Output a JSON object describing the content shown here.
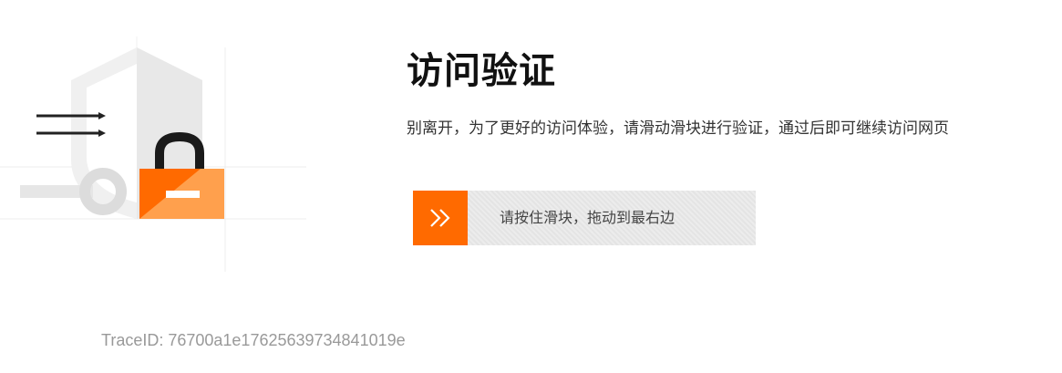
{
  "verification": {
    "title": "访问验证",
    "description": "别离开，为了更好的访问体验，请滑动滑块进行验证，通过后即可继续访问网页"
  },
  "slider": {
    "hint": "请按住滑块，拖动到最右边",
    "handle_icon": "double-chevron-right-icon"
  },
  "footer": {
    "trace_id": "TraceID: 76700a1e17625639734841019e"
  },
  "colors": {
    "accent": "#ff6a00",
    "lock_light": "#ffa04d",
    "track": "#e8e8e8",
    "trace_text": "#999999"
  },
  "illustration": {
    "icons": [
      "shield-icon",
      "lock-icon",
      "arrows-icon",
      "key-icon"
    ]
  }
}
